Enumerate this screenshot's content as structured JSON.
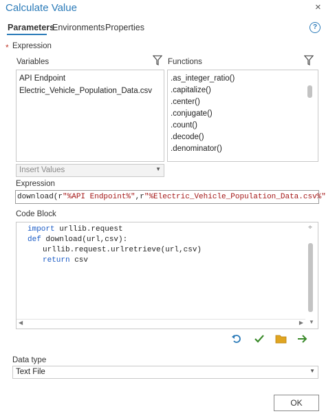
{
  "window": {
    "title": "Calculate Value",
    "close_glyph": "×"
  },
  "tabs": [
    {
      "label": "Parameters",
      "active": true
    },
    {
      "label": "Environments",
      "active": false
    },
    {
      "label": "Properties",
      "active": false
    }
  ],
  "help_glyph": "?",
  "expression_section": {
    "required_marker": "*",
    "label": "Expression",
    "variables_label": "Variables",
    "functions_label": "Functions",
    "variables": [
      "API Endpoint",
      "Electric_Vehicle_Population_Data.csv"
    ],
    "functions": [
      ".as_integer_ratio()",
      ".capitalize()",
      ".center()",
      ".conjugate()",
      ".count()",
      ".decode()",
      ".denominator()"
    ],
    "insert_values_placeholder": "Insert Values",
    "expression_label": "Expression",
    "expression_parts": {
      "a": "download(r",
      "b": "\"%API Endpoint%\"",
      "c": ",r",
      "d": "\"%Electric_Vehicle_Population_Data.csv%\"",
      "e": ")"
    }
  },
  "code_block": {
    "label": "Code Block",
    "line1": {
      "kw": "import",
      "rest": " urllib.request"
    },
    "line2": {
      "kw": "def",
      "rest": " download(url,csv):"
    },
    "line3": "urllib.request.urlretrieve(url,csv)",
    "line4": {
      "kw": "return",
      "rest": " csv"
    }
  },
  "toolbar": {
    "undo_icon": "undo-icon",
    "verify_icon": "checkmark-icon",
    "open_icon": "folder-icon",
    "run_icon": "arrow-right-icon"
  },
  "data_type": {
    "label": "Data type",
    "value": "Text File"
  },
  "ok_label": "OK",
  "colors": {
    "accent": "#2a7ab8",
    "keyword": "#1a5bc6",
    "string": "#a31515",
    "check": "#3a8a2a",
    "folder": "#e0a521"
  }
}
